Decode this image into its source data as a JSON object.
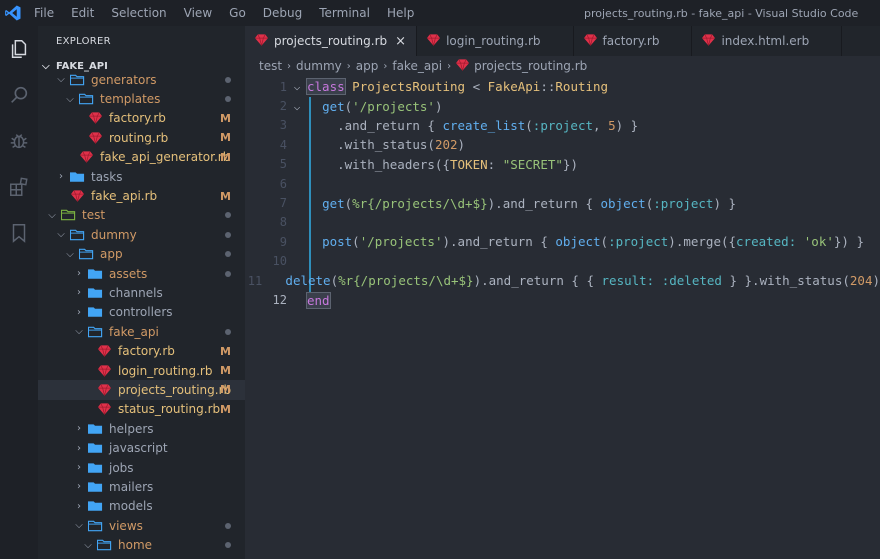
{
  "menu": [
    "File",
    "Edit",
    "Selection",
    "View",
    "Go",
    "Debug",
    "Terminal",
    "Help"
  ],
  "window_title": "projects_routing.rb - fake_api - Visual Studio Code",
  "sidebar": {
    "header": "EXPLORER",
    "project": "FAKE_API",
    "tree": [
      {
        "label": "generators",
        "type": "folder",
        "open": true,
        "depth": 1,
        "status": "dot"
      },
      {
        "label": "templates",
        "type": "folder",
        "open": true,
        "depth": 2,
        "status": "dot"
      },
      {
        "label": "factory.rb",
        "type": "ruby",
        "depth": 3,
        "status": "M"
      },
      {
        "label": "routing.rb",
        "type": "ruby",
        "depth": 3,
        "status": "M"
      },
      {
        "label": "fake_api_generator.rb",
        "type": "ruby",
        "depth": 2,
        "status": "M"
      },
      {
        "label": "tasks",
        "type": "folder",
        "open": false,
        "depth": 1,
        "status": ""
      },
      {
        "label": "fake_api.rb",
        "type": "ruby",
        "depth": 1,
        "status": "M"
      },
      {
        "label": "test",
        "type": "folder-test",
        "open": true,
        "depth": 0,
        "status": "dot"
      },
      {
        "label": "dummy",
        "type": "folder",
        "open": true,
        "depth": 1,
        "status": "dot"
      },
      {
        "label": "app",
        "type": "folder",
        "open": true,
        "depth": 2,
        "status": "dot"
      },
      {
        "label": "assets",
        "type": "folder",
        "open": false,
        "depth": 3,
        "status": "dot"
      },
      {
        "label": "channels",
        "type": "folder",
        "open": false,
        "depth": 3,
        "status": ""
      },
      {
        "label": "controllers",
        "type": "folder",
        "open": false,
        "depth": 3,
        "status": ""
      },
      {
        "label": "fake_api",
        "type": "folder",
        "open": true,
        "depth": 3,
        "status": "dot"
      },
      {
        "label": "factory.rb",
        "type": "ruby",
        "depth": 4,
        "status": "M"
      },
      {
        "label": "login_routing.rb",
        "type": "ruby",
        "depth": 4,
        "status": "M"
      },
      {
        "label": "projects_routing.rb",
        "type": "ruby",
        "depth": 4,
        "status": "M",
        "active": true
      },
      {
        "label": "status_routing.rb",
        "type": "ruby",
        "depth": 4,
        "status": "M"
      },
      {
        "label": "helpers",
        "type": "folder",
        "open": false,
        "depth": 3,
        "status": ""
      },
      {
        "label": "javascript",
        "type": "folder",
        "open": false,
        "depth": 3,
        "status": ""
      },
      {
        "label": "jobs",
        "type": "folder",
        "open": false,
        "depth": 3,
        "status": ""
      },
      {
        "label": "mailers",
        "type": "folder",
        "open": false,
        "depth": 3,
        "status": ""
      },
      {
        "label": "models",
        "type": "folder",
        "open": false,
        "depth": 3,
        "status": ""
      },
      {
        "label": "views",
        "type": "folder",
        "open": true,
        "depth": 3,
        "status": "dot"
      },
      {
        "label": "home",
        "type": "folder",
        "open": true,
        "depth": 4,
        "status": "dot"
      }
    ]
  },
  "tabs": [
    {
      "label": "projects_routing.rb",
      "active": true,
      "close": "×"
    },
    {
      "label": "login_routing.rb",
      "active": false
    },
    {
      "label": "factory.rb",
      "active": false
    },
    {
      "label": "index.html.erb",
      "active": false
    }
  ],
  "breadcrumb": [
    "test",
    "dummy",
    "app",
    "fake_api",
    "projects_routing.rb"
  ],
  "editor": {
    "lines": [
      {
        "n": "1",
        "fold": "⌵",
        "tokens": [
          [
            "kw kw-box",
            "class"
          ],
          [
            "punc",
            " "
          ],
          [
            "cls",
            "ProjectsRouting"
          ],
          [
            "punc",
            " < "
          ],
          [
            "cls",
            "FakeApi"
          ],
          [
            "punc",
            "::"
          ],
          [
            "cls",
            "Routing"
          ]
        ]
      },
      {
        "n": "2",
        "fold": "⌵",
        "tokens": [
          [
            "punc",
            "  "
          ],
          [
            "fn",
            "get"
          ],
          [
            "punc",
            "("
          ],
          [
            "str",
            "'/projects'"
          ],
          [
            "punc",
            ")"
          ]
        ]
      },
      {
        "n": "3",
        "fold": "",
        "tokens": [
          [
            "punc",
            "    .and_return { "
          ],
          [
            "fn",
            "create_list"
          ],
          [
            "punc",
            "("
          ],
          [
            "sym",
            ":project"
          ],
          [
            "punc",
            ", "
          ],
          [
            "num",
            "5"
          ],
          [
            "punc",
            ") }"
          ]
        ]
      },
      {
        "n": "4",
        "fold": "",
        "tokens": [
          [
            "punc",
            "    .with_status("
          ],
          [
            "num",
            "202"
          ],
          [
            "punc",
            ")"
          ]
        ]
      },
      {
        "n": "5",
        "fold": "",
        "tokens": [
          [
            "punc",
            "    .with_headers({"
          ],
          [
            "cls",
            "TOKEN"
          ],
          [
            "punc",
            ": "
          ],
          [
            "str",
            "\"SECRET\""
          ],
          [
            "punc",
            "})"
          ]
        ]
      },
      {
        "n": "6",
        "fold": "",
        "tokens": [
          [
            "punc",
            ""
          ]
        ]
      },
      {
        "n": "7",
        "fold": "",
        "tokens": [
          [
            "punc",
            "  "
          ],
          [
            "fn",
            "get"
          ],
          [
            "punc",
            "("
          ],
          [
            "str",
            "%r{/projects/\\d+$}"
          ],
          [
            "punc",
            ").and_return { "
          ],
          [
            "fn",
            "object"
          ],
          [
            "punc",
            "("
          ],
          [
            "sym",
            ":project"
          ],
          [
            "punc",
            ") }"
          ]
        ]
      },
      {
        "n": "8",
        "fold": "",
        "tokens": [
          [
            "punc",
            ""
          ]
        ]
      },
      {
        "n": "9",
        "fold": "",
        "tokens": [
          [
            "punc",
            "  "
          ],
          [
            "fn",
            "post"
          ],
          [
            "punc",
            "("
          ],
          [
            "str",
            "'/projects'"
          ],
          [
            "punc",
            ").and_return { "
          ],
          [
            "fn",
            "object"
          ],
          [
            "punc",
            "("
          ],
          [
            "sym",
            ":project"
          ],
          [
            "punc",
            ").merge({"
          ],
          [
            "sym",
            "created:"
          ],
          [
            "punc",
            " "
          ],
          [
            "str",
            "'ok'"
          ],
          [
            "punc",
            "}) }"
          ]
        ]
      },
      {
        "n": "10",
        "fold": "",
        "tokens": [
          [
            "punc",
            ""
          ]
        ]
      },
      {
        "n": "11",
        "fold": "",
        "tokens": [
          [
            "punc",
            "  "
          ],
          [
            "fn",
            "delete"
          ],
          [
            "punc",
            "("
          ],
          [
            "str",
            "%r{/projects/\\d+$}"
          ],
          [
            "punc",
            ").and_return { { "
          ],
          [
            "sym",
            "result:"
          ],
          [
            "punc",
            " "
          ],
          [
            "sym",
            ":deleted"
          ],
          [
            "punc",
            " } }.with_status("
          ],
          [
            "num",
            "204"
          ],
          [
            "punc",
            ")"
          ]
        ]
      },
      {
        "n": "12",
        "fold": "",
        "cur": true,
        "tokens": [
          [
            "kw kw-box",
            "end"
          ]
        ]
      }
    ]
  },
  "colors": {
    "accent": "#3794ff",
    "ruby": "#e0314a",
    "folder": "#42a5f5",
    "test_folder": "#7cb342",
    "modified": "#d19a66"
  }
}
